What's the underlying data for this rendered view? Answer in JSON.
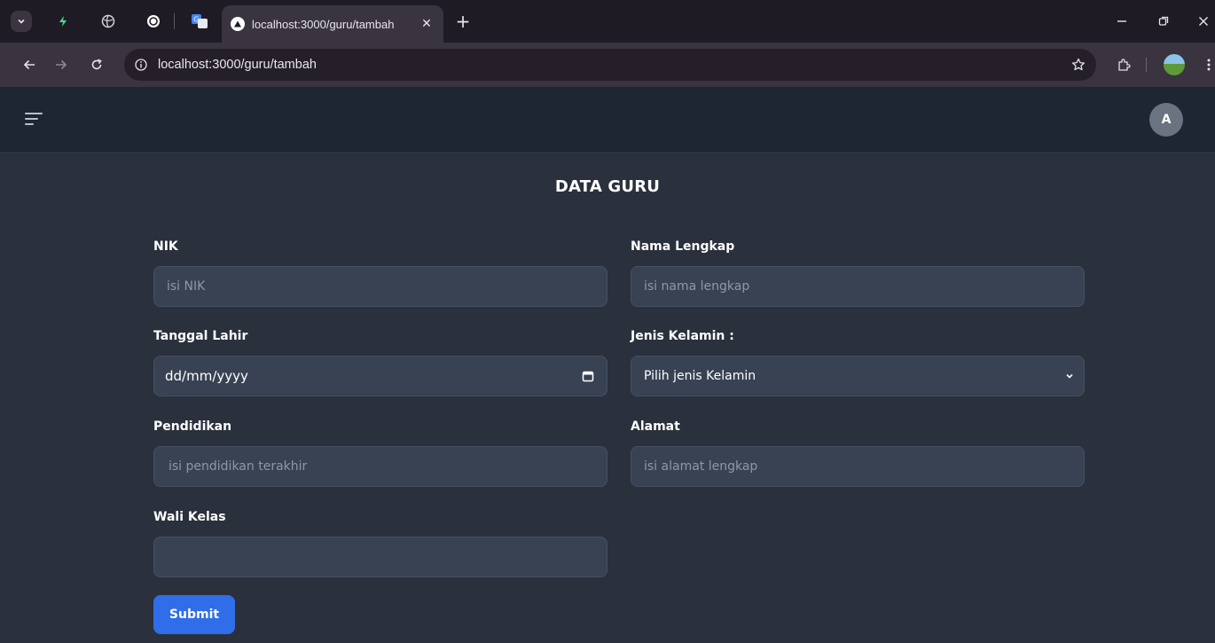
{
  "browser": {
    "tab": {
      "title": "localhost:3000/guru/tambah",
      "close_glyph": "✕"
    },
    "new_tab_glyph": "+",
    "url": "localhost:3000/guru/tambah",
    "icons": {
      "tab_search": "chevron-down-icon",
      "back": "arrow-left-icon",
      "forward": "arrow-right-icon",
      "reload": "reload-icon",
      "bookmark": "star-icon",
      "extensions": "puzzle-icon",
      "menu": "kebab-menu-icon"
    }
  },
  "app_header": {
    "avatar_letter": "A"
  },
  "form": {
    "title": "DATA GURU",
    "fields": {
      "nik": {
        "label": "NIK",
        "placeholder": "isi NIK"
      },
      "nama": {
        "label": "Nama Lengkap",
        "placeholder": "isi nama lengkap"
      },
      "tanggal_lahir": {
        "label": "Tanggal Lahir",
        "value": "dd/mm/yyyy"
      },
      "jenis_kelamin": {
        "label": "Jenis Kelamin :",
        "selected": "Pilih jenis Kelamin"
      },
      "pendidikan": {
        "label": "Pendidikan",
        "placeholder": "isi pendidikan terakhir"
      },
      "alamat": {
        "label": "Alamat",
        "placeholder": "isi alamat lengkap"
      },
      "wali_kelas": {
        "label": "Wali Kelas",
        "placeholder": ""
      }
    },
    "submit_label": "Submit"
  },
  "colors": {
    "primary": "#2f6ee8",
    "page_bg": "#2a303c",
    "header_bg": "#1e2632",
    "input_bg": "#394253"
  }
}
